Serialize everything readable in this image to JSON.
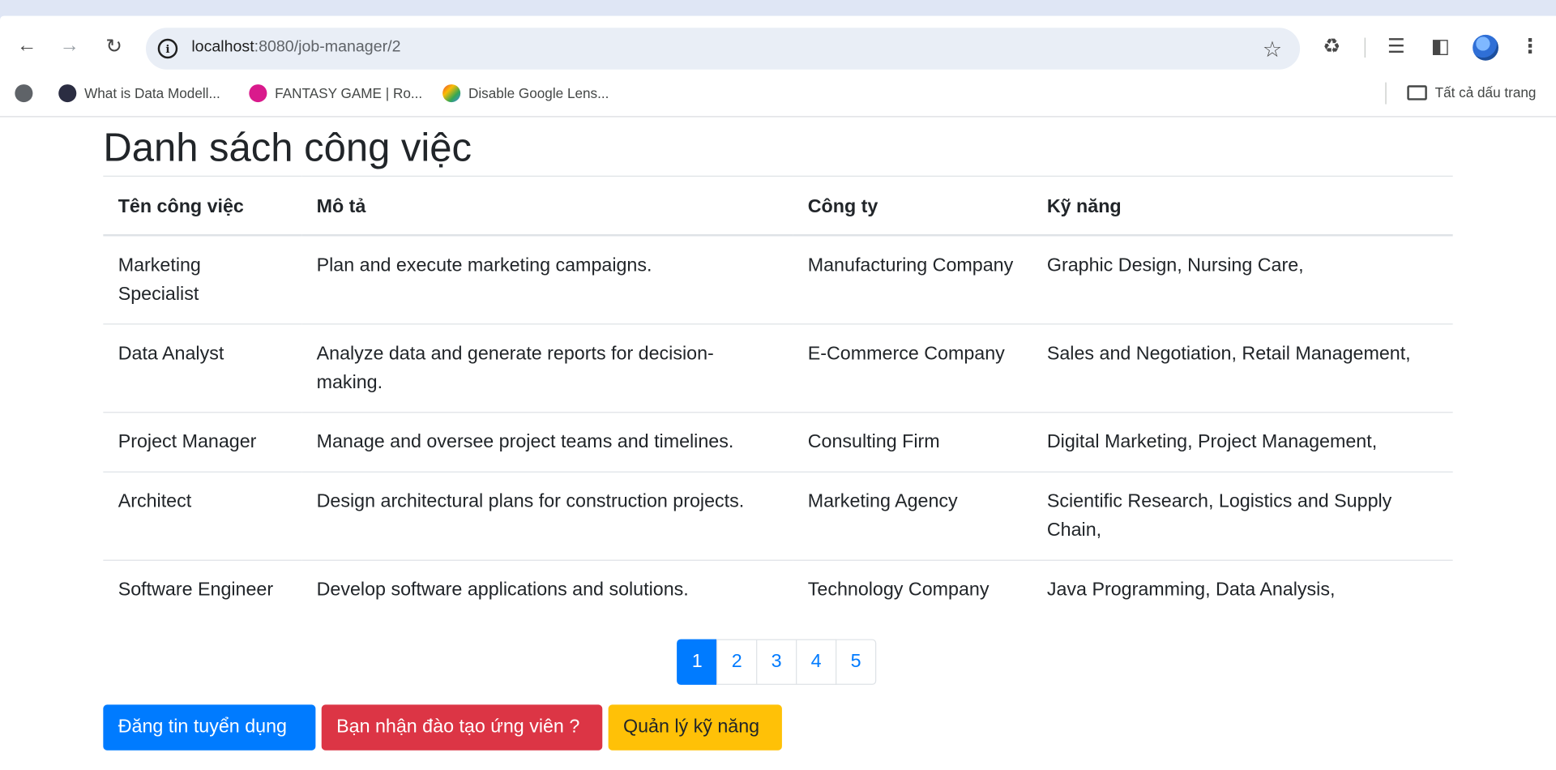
{
  "browser": {
    "url_host": "localhost",
    "url_path": ":8080/job-manager/2",
    "bookmarks": [
      {
        "label": "What is Data Modell...",
        "color": "#2b2d42"
      },
      {
        "label": "FANTASY GAME | Ro...",
        "color": "#d91a8c"
      },
      {
        "label": "Disable Google Lens...",
        "color": "#f4b400"
      }
    ],
    "all_bookmarks_label": "Tất cả dấu trang"
  },
  "page": {
    "title": "Danh sách công việc",
    "table": {
      "headers": [
        "Tên công việc",
        "Mô tả",
        "Công ty",
        "Kỹ năng"
      ],
      "rows": [
        [
          "Marketing Specialist",
          "Plan and execute marketing campaigns.",
          "Manufacturing Company",
          "Graphic Design, Nursing Care,"
        ],
        [
          "Data Analyst",
          "Analyze data and generate reports for decision-making.",
          "E-Commerce Company",
          "Sales and Negotiation, Retail Management,"
        ],
        [
          "Project Manager",
          "Manage and oversee project teams and timelines.",
          "Consulting Firm",
          "Digital Marketing, Project Management,"
        ],
        [
          "Architect",
          "Design architectural plans for construction projects.",
          "Marketing Agency",
          "Scientific Research, Logistics and Supply Chain,"
        ],
        [
          "Software Engineer",
          "Develop software applications and solutions.",
          "Technology Company",
          "Java Programming, Data Analysis,"
        ]
      ]
    },
    "pagination": {
      "pages": [
        "1",
        "2",
        "3",
        "4",
        "5"
      ],
      "active": "1"
    },
    "buttons": {
      "post_job": "Đăng tin tuyển dụng",
      "training": "Bạn nhận đào tạo ứng viên ?",
      "skills": "Quản lý kỹ năng"
    }
  }
}
